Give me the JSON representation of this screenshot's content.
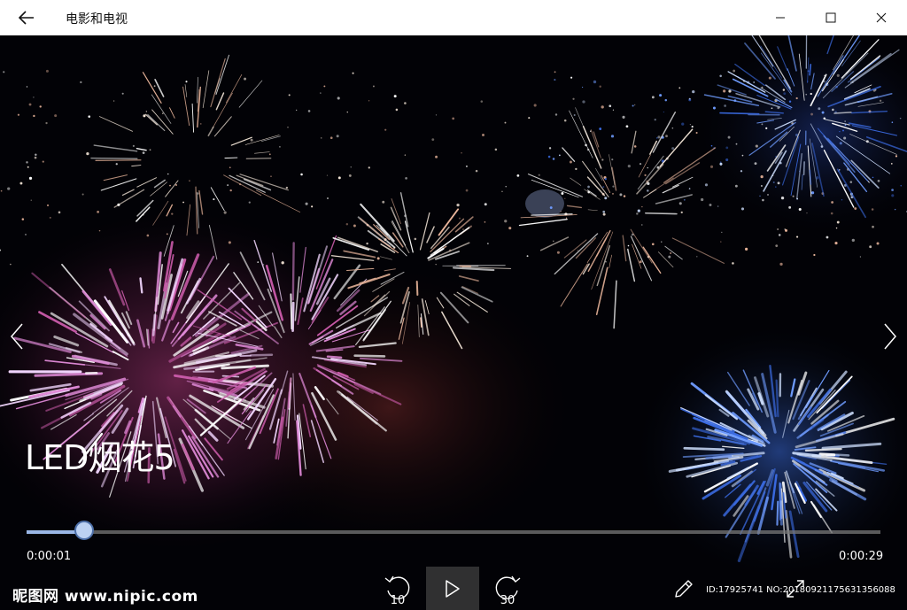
{
  "window": {
    "title": "电影和电视",
    "icons": {
      "back": "arrow-left-icon",
      "minimize": "minimize-icon",
      "maximize": "maximize-icon",
      "close": "close-icon"
    }
  },
  "video": {
    "title": "LED烟花5",
    "current_time": "0:00:01",
    "total_time": "0:00:29",
    "progress_fraction": 0.067,
    "skip_back_seconds": "10",
    "skip_forward_seconds": "30",
    "accent_color": "#9ab7e6"
  },
  "controls": {
    "icons": {
      "prev": "chevron-left-icon",
      "next": "chevron-right-icon",
      "skip_back": "skip-back-icon",
      "play": "play-icon",
      "skip_forward": "skip-forward-icon",
      "edit": "pencil-icon",
      "fullscreen": "fullscreen-icon"
    }
  },
  "watermarks": {
    "left": "昵图网 www.nipic.com",
    "right": "ID:17925741 NO:20180921175631356088"
  }
}
